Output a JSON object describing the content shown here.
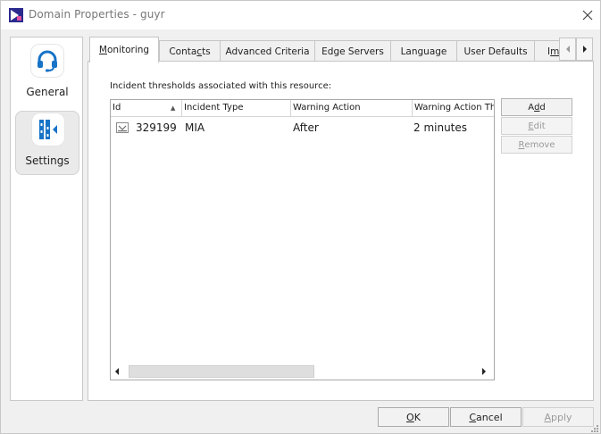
{
  "window": {
    "title": "Domain Properties - guyr"
  },
  "sidebar": {
    "items": [
      {
        "label": "General",
        "icon": "headset-icon",
        "selected": false
      },
      {
        "label": "Settings",
        "icon": "settings-columns-icon",
        "selected": true
      }
    ]
  },
  "tabs": [
    {
      "prefix": "",
      "key": "M",
      "rest": "onitoring",
      "active": true
    },
    {
      "prefix": "Conta",
      "key": "c",
      "rest": "ts",
      "active": false
    },
    {
      "prefix": "Advanced Criteria",
      "key": "",
      "rest": "",
      "active": false
    },
    {
      "prefix": "Edge Servers",
      "key": "",
      "rest": "",
      "active": false
    },
    {
      "prefix": "Language",
      "key": "",
      "rest": "",
      "active": false
    },
    {
      "prefix": "User Defaults",
      "key": "",
      "rest": "",
      "active": false
    },
    {
      "prefix": "I",
      "key": "m",
      "rest": "",
      "active": false
    }
  ],
  "monitoring": {
    "label": "Incident thresholds associated with this resource:",
    "columns": [
      "Id",
      "Incident Type",
      "Warning Action",
      "Warning Action Thre"
    ],
    "sort_indicator": "▲",
    "rows": [
      {
        "id": "329199",
        "incident_type": "MIA",
        "warning_action": "After",
        "threshold": "2 minutes"
      }
    ],
    "buttons": {
      "add": {
        "pre": "A",
        "key": "d",
        "post": "d"
      },
      "edit": {
        "pre": "",
        "key": "E",
        "post": "dit"
      },
      "remove": {
        "pre": "",
        "key": "R",
        "post": "emove"
      }
    }
  },
  "footer": {
    "ok": {
      "pre": "",
      "key": "O",
      "post": "K"
    },
    "cancel": {
      "pre": "",
      "key": "C",
      "post": "ancel"
    },
    "apply": {
      "pre": "",
      "key": "A",
      "post": "pply"
    }
  },
  "colors": {
    "brand_icon": "#2a2a8e",
    "accent_blue": "#1673c6",
    "selected_nav_bg": "#eaeaea"
  }
}
